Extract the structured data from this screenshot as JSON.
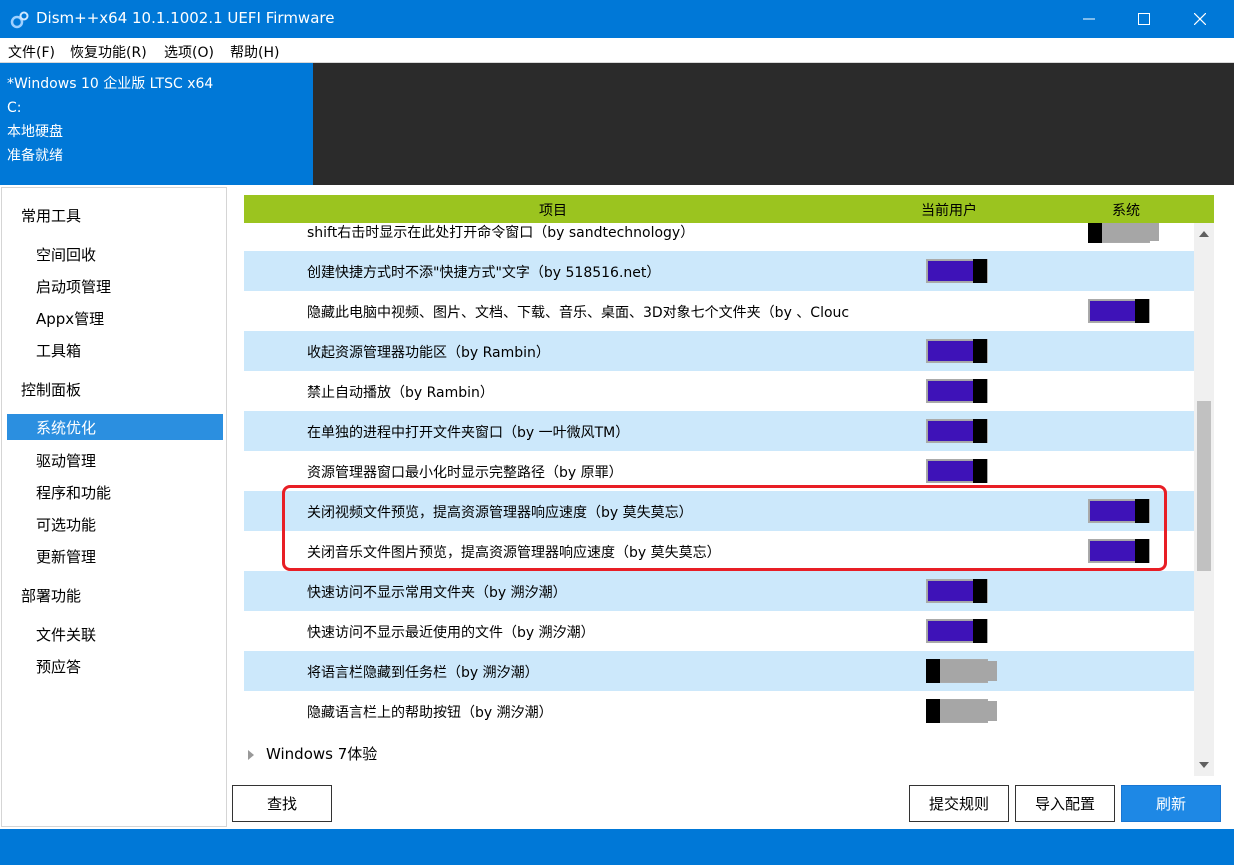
{
  "window": {
    "title": "Dism++x64 10.1.1002.1 UEFI Firmware"
  },
  "menu": [
    "文件(F)",
    "恢复功能(R)",
    "选项(O)",
    "帮助(H)"
  ],
  "info": {
    "line1": "*Windows 10 企业版 LTSC x64",
    "line2": "C:",
    "line3": "本地硬盘",
    "line4": "准备就绪"
  },
  "sidebar": {
    "cat1": "常用工具",
    "items1": [
      "空间回收",
      "启动项管理",
      "Appx管理",
      "工具箱"
    ],
    "cat2": "控制面板",
    "active": "系统优化",
    "items2": [
      "驱动管理",
      "程序和功能",
      "可选功能",
      "更新管理"
    ],
    "cat3": "部署功能",
    "items3": [
      "文件关联",
      "预应答"
    ]
  },
  "table": {
    "col_item": "项目",
    "col_user": "当前用户",
    "col_system": "系统",
    "rows": [
      {
        "label": "shift右击时显示在此处打开命令窗口（by sandtechnology）",
        "user": null,
        "system": false
      },
      {
        "label": "创建快捷方式时不添\"快捷方式\"文字（by 518516.net）",
        "user": true,
        "system": null
      },
      {
        "label": "隐藏此电脑中视频、图片、文档、下载、音乐、桌面、3D对象七个文件夹（by 、Clouc",
        "user": null,
        "system": true
      },
      {
        "label": "收起资源管理器功能区（by Rambin）",
        "user": true,
        "system": null
      },
      {
        "label": "禁止自动播放（by Rambin）",
        "user": true,
        "system": null
      },
      {
        "label": "在单独的进程中打开文件夹窗口（by 一叶微风TM）",
        "user": true,
        "system": null
      },
      {
        "label": "资源管理器窗口最小化时显示完整路径（by 原罪）",
        "user": true,
        "system": null
      },
      {
        "label": "关闭视频文件预览，提高资源管理器响应速度（by 莫失莫忘）",
        "user": null,
        "system": true
      },
      {
        "label": "关闭音乐文件图片预览，提高资源管理器响应速度（by 莫失莫忘）",
        "user": null,
        "system": true
      },
      {
        "label": "快速访问不显示常用文件夹（by 溯汐潮）",
        "user": true,
        "system": null
      },
      {
        "label": "快速访问不显示最近使用的文件（by 溯汐潮）",
        "user": true,
        "system": null
      },
      {
        "label": "将语言栏隐藏到任务栏（by 溯汐潮）",
        "user": false,
        "system": null
      },
      {
        "label": "隐藏语言栏上的帮助按钮（by 溯汐潮）",
        "user": false,
        "system": null
      }
    ],
    "group": "Windows 7体验"
  },
  "buttons": {
    "find": "查找",
    "submit_rule": "提交规则",
    "import_config": "导入配置",
    "refresh": "刷新"
  },
  "colors": {
    "accent": "#0078d7",
    "header": "#9bc41f",
    "toggle_on": "#3e12b8",
    "highlight": "#e81e25"
  }
}
